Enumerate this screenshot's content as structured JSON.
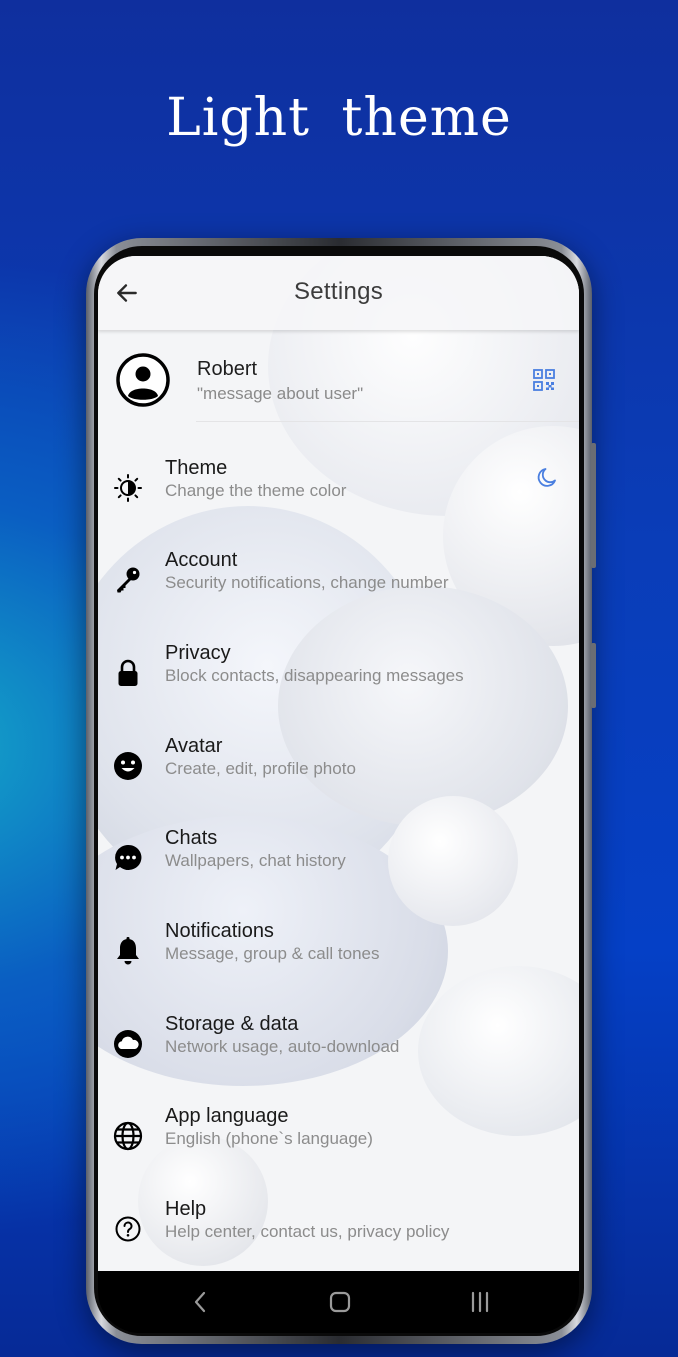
{
  "headline": "Light  theme",
  "appbar": {
    "title": "Settings"
  },
  "profile": {
    "name": "Robert",
    "status": "\"message about user\""
  },
  "settings": [
    {
      "title": "Theme",
      "subtitle": "Change the theme color",
      "icon": "theme-brightness-icon"
    },
    {
      "title": "Account",
      "subtitle": "Security notifications, change number",
      "icon": "key-icon"
    },
    {
      "title": "Privacy",
      "subtitle": "Block contacts, disappearing messages",
      "icon": "lock-icon"
    },
    {
      "title": "Avatar",
      "subtitle": "Create, edit, profile photo",
      "icon": "smiley-icon"
    },
    {
      "title": "Chats",
      "subtitle": "Wallpapers, chat history",
      "icon": "chat-bubble-icon"
    },
    {
      "title": "Notifications",
      "subtitle": "Message, group & call tones",
      "icon": "bell-icon"
    },
    {
      "title": "Storage & data",
      "subtitle": "Network usage, auto-download",
      "icon": "cloud-icon"
    },
    {
      "title": "App language",
      "subtitle": "English (phone`s language)",
      "icon": "globe-icon"
    },
    {
      "title": "Help",
      "subtitle": "Help center, contact us, privacy policy",
      "icon": "help-circle-icon"
    }
  ],
  "colors": {
    "accent": "#4a7fe0",
    "background_top": "#0f2f9e",
    "background_glow": "#14a7c9"
  }
}
